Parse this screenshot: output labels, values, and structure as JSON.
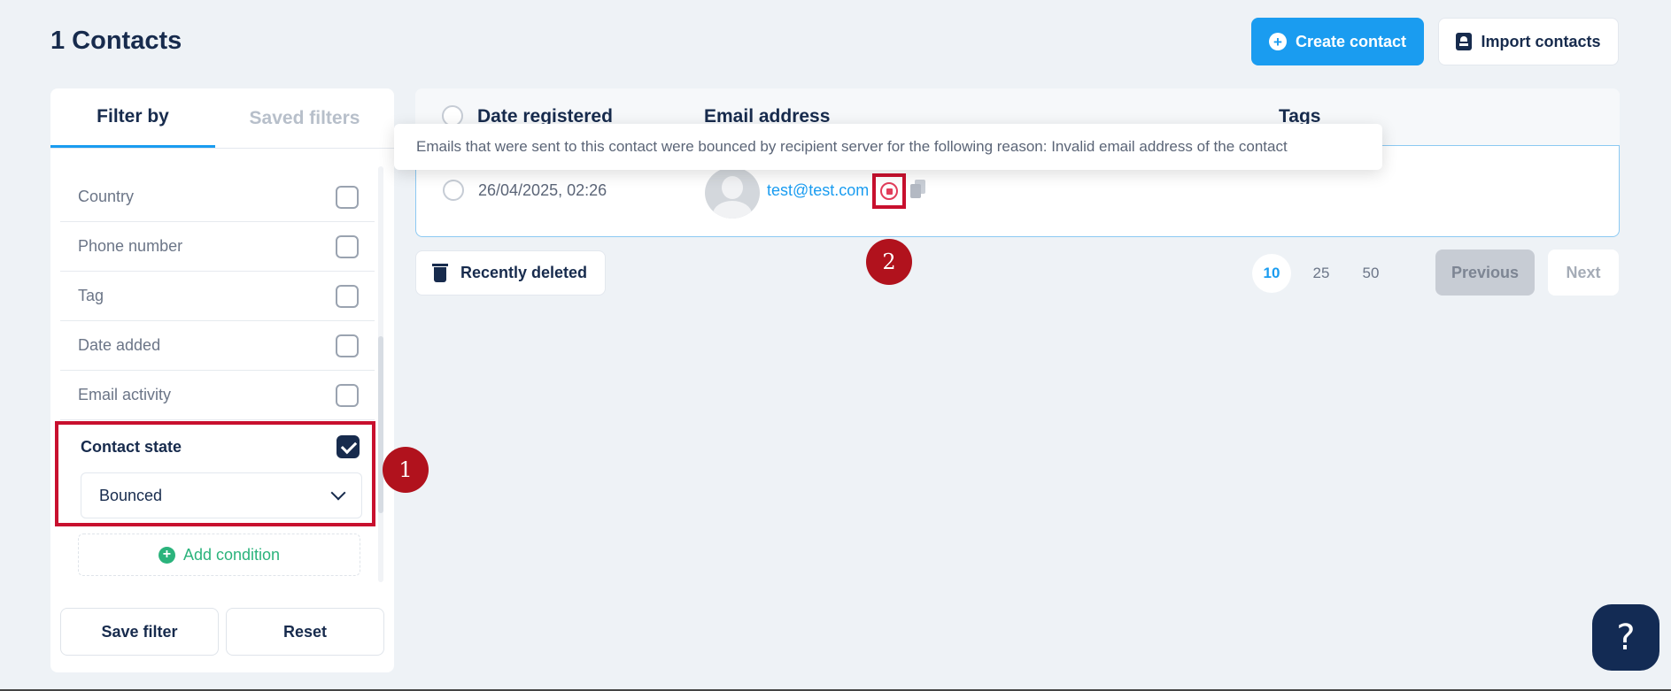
{
  "header": {
    "title": "1 Contacts",
    "create_label": "Create contact",
    "import_label": "Import contacts"
  },
  "sidebar": {
    "tabs": [
      "Filter by",
      "Saved filters"
    ],
    "filters": [
      "Country",
      "Phone number",
      "Tag",
      "Date added",
      "Email activity"
    ],
    "contact_state": {
      "label": "Contact state",
      "checked": true,
      "selected_value": "Bounced"
    },
    "add_condition_label": "Add condition",
    "save_label": "Save filter",
    "reset_label": "Reset"
  },
  "table": {
    "columns": [
      "Date registered",
      "Email address",
      "Tags"
    ],
    "rows": [
      {
        "date": "26/04/2025, 02:26",
        "email": "test@test.com"
      }
    ],
    "tooltip": "Emails that were sent to this contact were bounced by recipient server for the following reason: Invalid email address of the contact"
  },
  "footer": {
    "recently_deleted_label": "Recently deleted",
    "page_sizes": [
      "10",
      "25",
      "50"
    ],
    "active_page_size": "10",
    "previous_label": "Previous",
    "next_label": "Next"
  },
  "annotations": {
    "marker_1": "1",
    "marker_2": "2"
  },
  "help": {
    "label": "?"
  },
  "colors": {
    "primary": "#1a9cf0",
    "navy": "#172b4d",
    "highlight_red": "#c8102e",
    "success_green": "#2bb37c",
    "background": "#eef2f6"
  }
}
